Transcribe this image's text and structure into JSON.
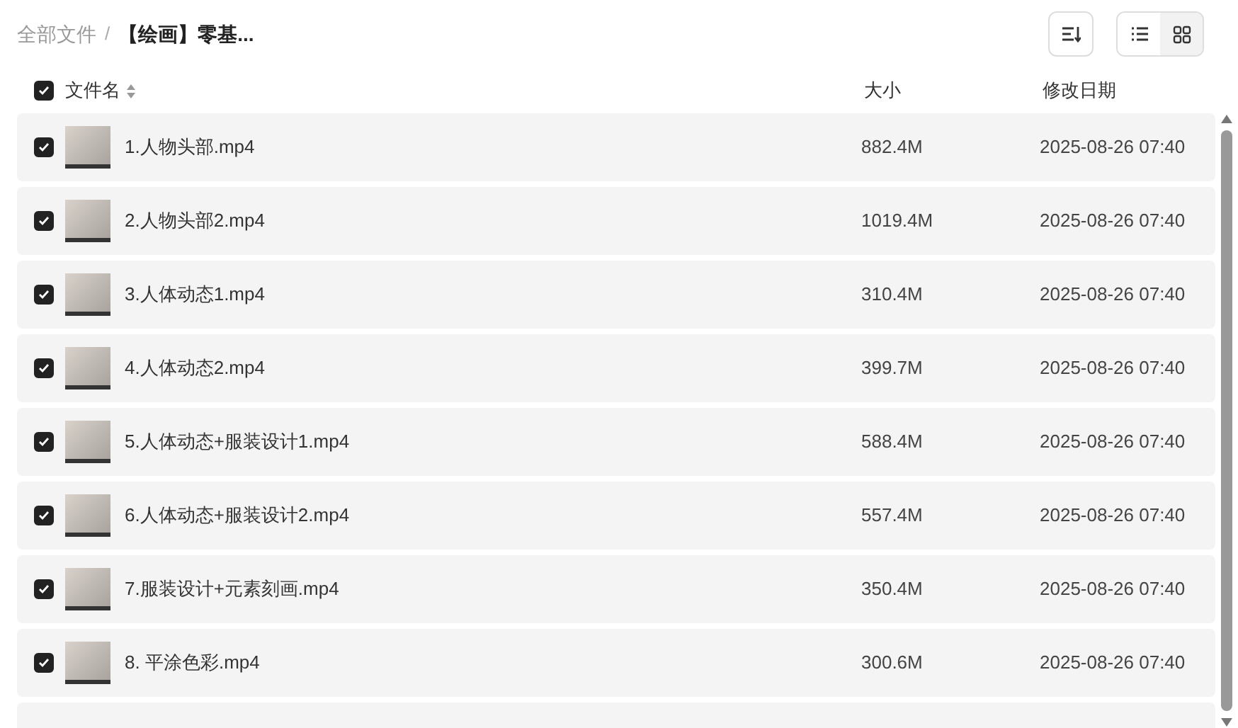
{
  "breadcrumb": [
    {
      "label": "全部文件",
      "current": false
    },
    {
      "label": "【绘画】零基...",
      "current": true
    }
  ],
  "breadcrumb_separator": "/",
  "view_toggle": [
    {
      "kind": "list",
      "selected": true
    },
    {
      "kind": "grid",
      "selected": false
    }
  ],
  "header": {
    "checked": true,
    "columns": [
      "文件名",
      "大小",
      "修改日期"
    ]
  },
  "rows": [
    {
      "name": "1.人物头部.mp4",
      "size": "882.4M",
      "date": "2025-08-26 07:40",
      "checked": true
    },
    {
      "name": "2.人物头部2.mp4",
      "size": "1019.4M",
      "date": "2025-08-26 07:40",
      "checked": true
    },
    {
      "name": "3.人体动态1.mp4",
      "size": "310.4M",
      "date": "2025-08-26 07:40",
      "checked": true
    },
    {
      "name": "4.人体动态2.mp4",
      "size": "399.7M",
      "date": "2025-08-26 07:40",
      "checked": true
    },
    {
      "name": "5.人体动态+服装设计1.mp4",
      "size": "588.4M",
      "date": "2025-08-26 07:40",
      "checked": true
    },
    {
      "name": "6.人体动态+服装设计2.mp4",
      "size": "557.4M",
      "date": "2025-08-26 07:40",
      "checked": true
    },
    {
      "name": "7.服装设计+元素刻画.mp4",
      "size": "350.4M",
      "date": "2025-08-26 07:40",
      "checked": true
    },
    {
      "name": "8. 平涂色彩.mp4",
      "size": "300.6M",
      "date": "2025-08-26 07:40",
      "checked": true
    }
  ]
}
